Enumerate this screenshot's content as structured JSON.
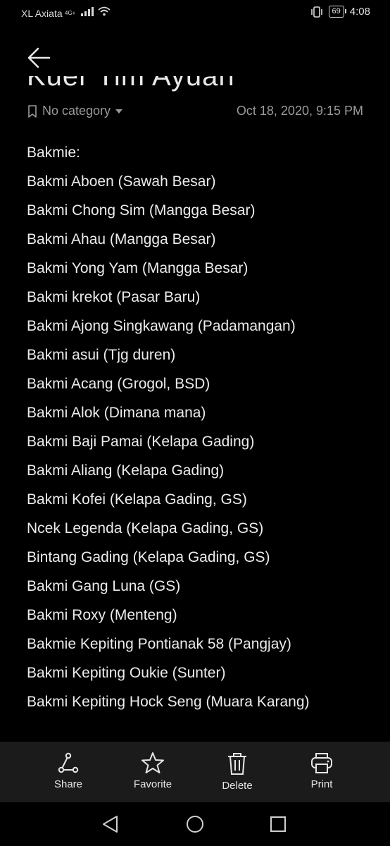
{
  "status": {
    "carrier": "XL Axiata",
    "network": "4G+",
    "battery": "69",
    "time": "4:08"
  },
  "note": {
    "title_partial": "Kuer Tim Ayuan",
    "category": "No category",
    "datetime": "Oct 18, 2020, 9:15 PM",
    "lines": [
      "Bakmie:",
      "Bakmi Aboen (Sawah Besar)",
      "Bakmi Chong Sim (Mangga Besar)",
      "Bakmi Ahau (Mangga Besar)",
      "Bakmi Yong Yam (Mangga Besar)",
      "Bakmi krekot (Pasar Baru)",
      "Bakmi Ajong Singkawang (Padamangan)",
      "Bakmi asui (Tjg duren)",
      "Bakmi Acang (Grogol, BSD)",
      "Bakmi Alok (Dimana mana)",
      "Bakmi Baji Pamai (Kelapa Gading)",
      "Bakmi Aliang (Kelapa Gading)",
      "Bakmi Kofei (Kelapa Gading, GS)",
      "Ncek Legenda (Kelapa Gading, GS)",
      "Bintang Gading (Kelapa Gading, GS)",
      "Bakmi Gang Luna (GS)",
      "Bakmi Roxy (Menteng)",
      "Bakmie Kepiting Pontianak 58 (Pangjay)",
      "Bakmi Kepiting Oukie (Sunter)",
      "Bakmi Kepiting Hock Seng (Muara Karang)"
    ]
  },
  "toolbar": {
    "share": "Share",
    "favorite": "Favorite",
    "delete": "Delete",
    "print": "Print"
  },
  "icons": {
    "back": "arrow-left-icon",
    "category": "bookmark-icon",
    "share": "share-icon",
    "favorite": "star-icon",
    "delete": "trash-icon",
    "print": "printer-icon",
    "nav_back": "triangle-back-icon",
    "nav_home": "circle-home-icon",
    "nav_recent": "square-recent-icon"
  },
  "colors": {
    "background": "#000000",
    "text": "#ececec",
    "meta": "#9a9a9a",
    "toolbar": "#1b1b1b"
  }
}
